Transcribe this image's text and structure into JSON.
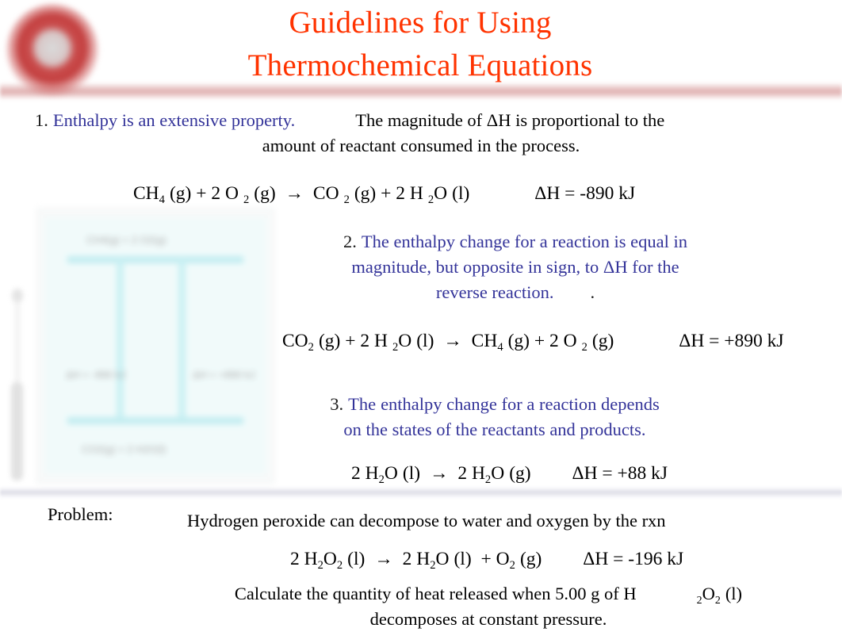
{
  "slide": {
    "title_line1": "Guidelines for Using",
    "title_line2": "Thermochemical Equations",
    "title_color": "#ff3300",
    "accent_blue": "#333399",
    "logo_name": "red-ring-logo"
  },
  "points": [
    {
      "number": "1.",
      "heading": "Enthalpy is an extensive property.",
      "text_line1": "The magnitude of ΔH is proportional to the",
      "text_line2": "amount of reactant consumed in the process."
    },
    {
      "number": "2.",
      "line1": "The enthalpy change for a reaction is equal in",
      "line2": "magnitude, but opposite in sign, to ΔH for the",
      "line3": "reverse reaction.",
      "trailing": "."
    },
    {
      "number": "3.",
      "line1": "The",
      "line1b": "enthalpy change for a reaction depends",
      "line2": "on the states of the reactants and products."
    }
  ],
  "equations": {
    "eq1": {
      "reactant1": "CH",
      "reactant1_sub": "4",
      "reactant1_state": "(g)",
      "plus1": "+",
      "reactant2_coef": "2",
      "reactant2": "O",
      "reactant2_sub": "2",
      "reactant2_state": "(g)",
      "arrow": "→",
      "product1": "CO",
      "product1_sub": "2",
      "product1_state": "(g)",
      "plus2": "+",
      "product2_coef": "2",
      "product2a": "H",
      "product2_sub": "2",
      "product2b": "O",
      "product2_state": "(l)",
      "delta_h": "ΔH = -890 kJ"
    },
    "eq2": {
      "reactant1": "CO",
      "reactant1_sub": "2",
      "reactant1_state": "(g)",
      "plus1": "+",
      "reactant2_coef": "2",
      "reactant2a": "H",
      "reactant2_sub": "2",
      "reactant2b": "O",
      "reactant2_state": "(l)",
      "arrow": "→",
      "product1": "CH",
      "product1_sub": "4",
      "product1_state": "(g)",
      "plus2": "+",
      "product2_coef": "2",
      "product2": "O",
      "product2_sub": "2",
      "product2_state": "(g)",
      "delta_h": "ΔH = +890 kJ"
    },
    "eq3": {
      "reactant_coef": "2",
      "reactant_a": "H",
      "reactant_sub": "2",
      "reactant_b": "O",
      "reactant_state": "(l)",
      "arrow": "→",
      "product_coef": "2",
      "product_a": "H",
      "product_sub": "2",
      "product_b": "O",
      "product_state": "(g)",
      "delta_h": "ΔH = +88 kJ"
    },
    "eq4": {
      "reactant_coef": "2",
      "reactant_a": "H",
      "reactant_sub1": "2",
      "reactant_b": "O",
      "reactant_sub2": "2",
      "reactant_state": "(l)",
      "arrow": "→",
      "product1_coef": "2",
      "product1_a": "H",
      "product1_sub": "2",
      "product1_b": "O",
      "product1_state": "(l)",
      "plus": "+",
      "product2": "O",
      "product2_sub": "2",
      "product2_state": "(g)",
      "delta_h": "ΔH = -196 kJ"
    }
  },
  "problem": {
    "label": "Problem:",
    "statement": "Hydrogen peroxide can decompose to water and oxygen by the rxn",
    "tail_line1a": "Calculate the quantity of heat released when 5.00 g of H",
    "tail_line1_sub1": "2",
    "tail_line1b": "O",
    "tail_line1_sub2": "2",
    "tail_line1c": "(l)",
    "tail_line2": "decomposes at constant pressure."
  },
  "figure": {
    "name": "enthalpy-diagram-image",
    "label_top": "CH4(g) + 2 O2(g)",
    "label_left": "ΔH = -890 kJ",
    "label_right": "ΔH = +890 kJ",
    "label_bottom": "CO2(g) + 2 H2O(l)"
  }
}
